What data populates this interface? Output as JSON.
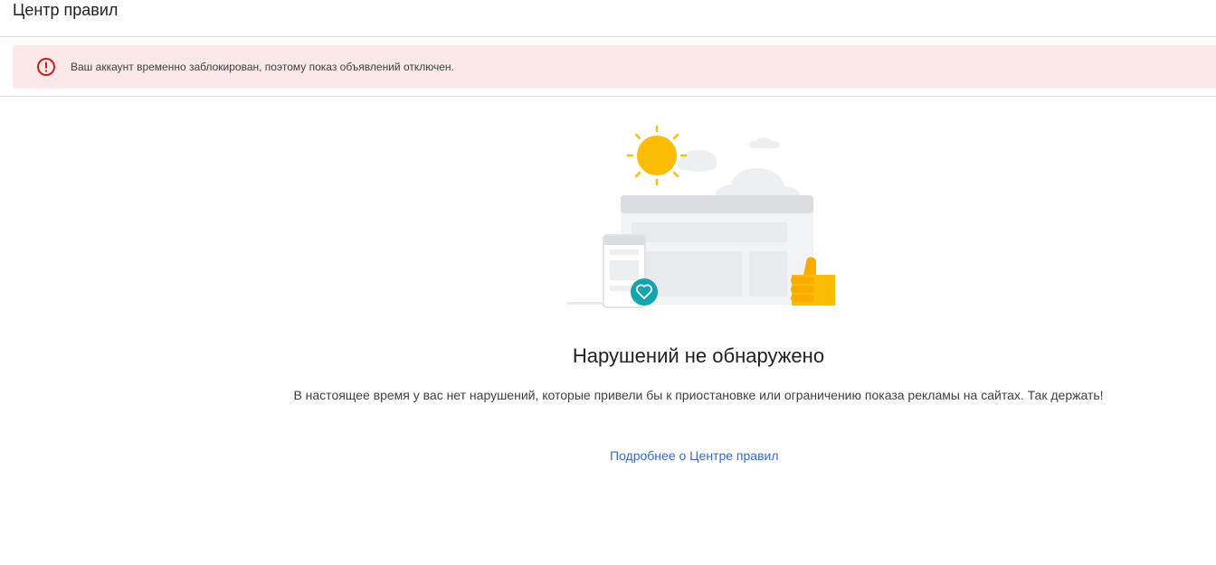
{
  "header": {
    "title": "Центр правил"
  },
  "alert": {
    "icon": "error-icon",
    "text": "Ваш аккаунт временно заблокирован, поэтому показ объявлений отключен.",
    "color": "#c5221f",
    "background": "#fce8e8"
  },
  "empty_state": {
    "illustration": "no-violations-illustration",
    "title": "Нарушений не обнаружено",
    "description": "В настоящее время у вас нет нарушений, которые привели бы к приостановке или ограничению показа рекламы на сайтах. Так держать!",
    "link_label": "Подробнее о Центре правил"
  },
  "colors": {
    "link": "#3367d6",
    "sun": "#fbbc04",
    "thumb": "#f9ab00",
    "heart_badge": "#12a4af"
  }
}
